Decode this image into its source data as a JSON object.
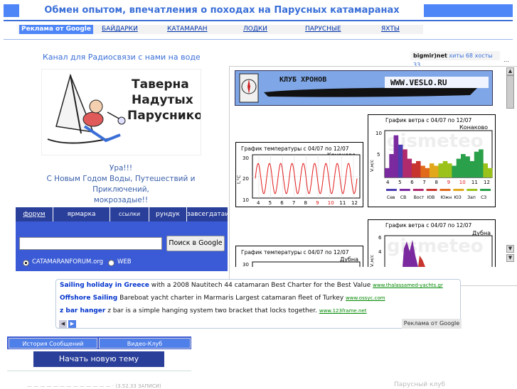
{
  "header": {
    "title": "Обмен опытом, впечатления о походах на Парусных катамаранах"
  },
  "nav": {
    "ads_label": "Реклама от Google",
    "items": [
      "БАЙДАРКИ",
      "КАТАМАРАН",
      "ЛОДКИ",
      "ПАРУСНЫЕ",
      "ЯХТЫ"
    ]
  },
  "channel": "Канал для Радиосвязи с нами на воде",
  "counter": {
    "brand": "bigmir)net",
    "hits_label": "хиты",
    "hits": "68",
    "hosts_label": "хосты",
    "hosts": "33"
  },
  "tavern_logo": {
    "line1": "Таверна",
    "line2": "Надутых",
    "line3": "Парусников"
  },
  "greeting": {
    "line1": "Ура!!!",
    "line2": "С Новым Годом Воды, Путешествий и Приключений,",
    "line3": "мокрозадые!!"
  },
  "tabs": [
    "форум",
    "ярмарка",
    "ссылки",
    "рундук",
    "завсегдатаи"
  ],
  "search": {
    "input_value": "",
    "button": "Поиск в Google",
    "option1": "CATAMARANFORUM.org",
    "option2": "WEB"
  },
  "club_banner": {
    "title": "КЛУБ ХРОНОВ",
    "url": "WWW.VESLO.RU"
  },
  "temp_chart_1": {
    "title": "График температуры с 04/07 по 12/07",
    "city": "Конаково",
    "ylabel": "t,°C",
    "yticks": [
      "30",
      "20",
      "10"
    ],
    "xticks": [
      "4",
      "5",
      "6",
      "7",
      "8",
      "9",
      "10",
      "11",
      "12"
    ]
  },
  "wind_chart_1": {
    "title": "График ветра с 04/07 по 12/07",
    "city": "Конаково",
    "ylabel": "V,м/с",
    "yticks": [
      "10",
      "5"
    ],
    "xticks": [
      "4",
      "5",
      "6",
      "7",
      "8",
      "9",
      "10",
      "11",
      "12"
    ],
    "directions": [
      "Сев",
      "СВ",
      "Вост",
      "ЮВ",
      "Южн",
      "ЮЗ",
      "Зап",
      "СЗ"
    ],
    "dir_colors": [
      "#4b3cb0",
      "#7a2a9e",
      "#b02a6e",
      "#c8342e",
      "#e06a1a",
      "#e0a81a",
      "#9ac21a",
      "#2aa04a"
    ],
    "watermark": "gismeteo"
  },
  "temp_chart_2": {
    "title": "График температуры с 04/07 по 12/07",
    "city": "Дубна",
    "ytick_top": "30"
  },
  "wind_chart_2": {
    "title": "График ветра с 04/07 по 12/07",
    "city": "Дубна",
    "ylabel": "V,м/с",
    "yticks": [
      "6",
      "4"
    ],
    "watermark": "gismeteo"
  },
  "ads": [
    {
      "title": "Sailing holiday in Greece",
      "text": " with a 2008 Nautitech 44 catamaran Best Charter for the Best Value ",
      "url": "www.thalassamed-yachts.gr"
    },
    {
      "title": "Offshore Sailing",
      "text": " Bareboat yacht charter in Marmaris Largest catamaran fleet of Turkey ",
      "url": "www.ossyc.com"
    },
    {
      "title": "z bar hanger",
      "text": " z bar is a simple hanging system two bracket that locks together. ",
      "url": "www.123frame.net"
    }
  ],
  "ads_footer": "Реклама от Google",
  "bottom": {
    "history": "История Сообщений",
    "video": "Видео-Клуб",
    "new_topic": "Начать новую тему"
  },
  "tail": {
    "left": "— — — — — — — — — — — — — · (3.52.33 ЗАПИСИ)",
    "right": "Парусный клуб"
  }
}
